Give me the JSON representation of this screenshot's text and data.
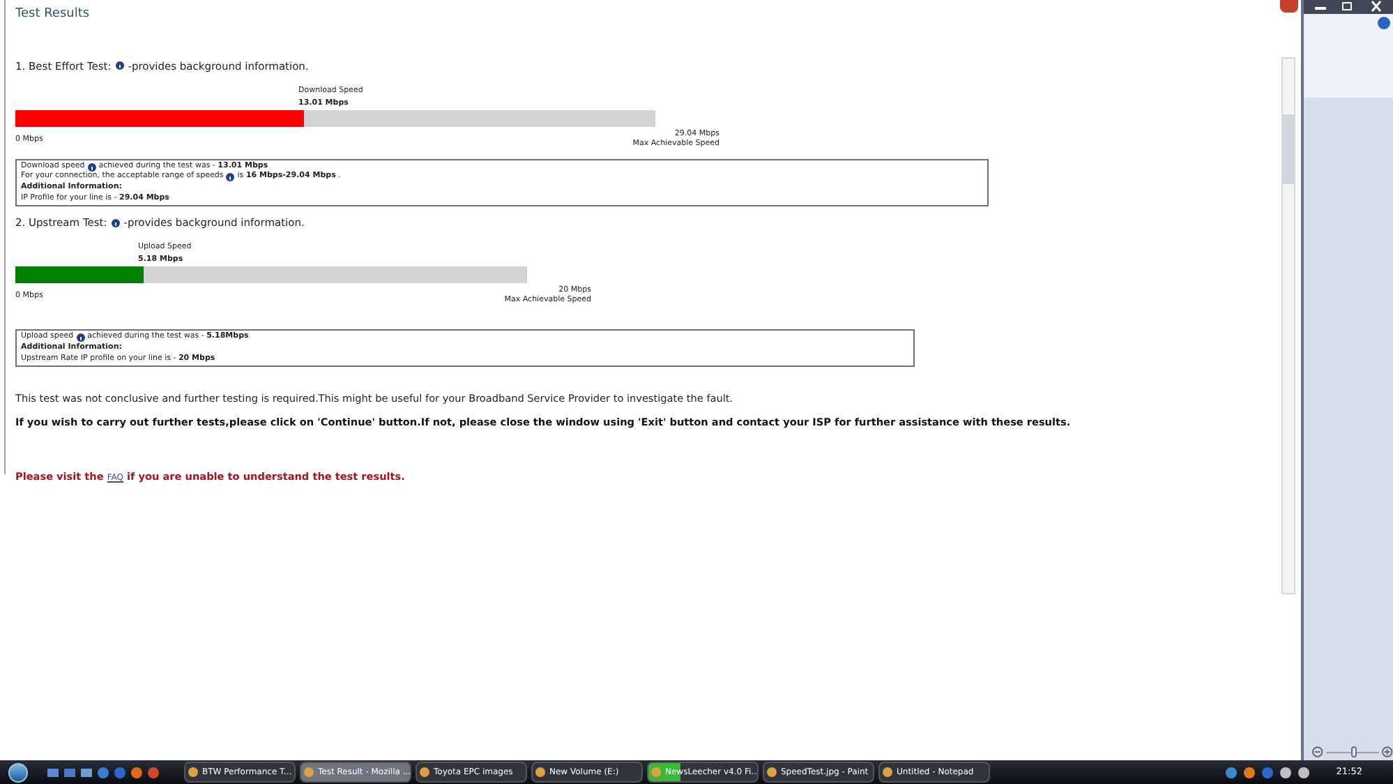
{
  "page": {
    "title": "Test Results",
    "tests": [
      {
        "name": "1. Best Effort Test:",
        "hint": "-provides background information.",
        "speed_label": "Download Speed",
        "speed": "13.01 Mbps",
        "level": 0.45,
        "color": "#ff0000",
        "min": "0 Mbps",
        "max": "29.04 Mbps",
        "max_caption": "Max Achievable Speed",
        "details": [
          {
            "kind": "text",
            "segments": [
              "Download speed",
              "achieved during the test was - **13.01 Mbps**"
            ]
          },
          {
            "kind": "text",
            "segments": [
              "For your connection, the acceptable range of speeds",
              "is **16 Mbps-29.04 Mbps** ."
            ]
          },
          {
            "kind": "label",
            "segments": [
              "Additional Information:"
            ]
          },
          {
            "kind": "text",
            "segments": [
              "IP Profile for your line is - **29.04 Mbps**"
            ]
          }
        ]
      },
      {
        "name": "2. Upstream Test:",
        "hint": "-provides background information.",
        "speed_label": "Upload Speed",
        "speed": "5.18 Mbps",
        "level": 0.25,
        "color": "#008000",
        "min": "0 Mbps",
        "max": "20 Mbps",
        "max_caption": "Max Achievable Speed",
        "details": [
          {
            "kind": "text",
            "segments": [
              "Upload speed",
              " achieved during the test was - **5.18Mbps**"
            ]
          },
          {
            "kind": "label",
            "segments": [
              "Additional Information:"
            ]
          },
          {
            "kind": "text",
            "segments": [
              "Upstream Rate IP profile on your line is - **20 Mbps**"
            ]
          }
        ]
      }
    ],
    "conclusion": "This test was not conclusive and further testing is required.This might be useful for your Broadband Service Provider to investigate the fault.",
    "instruction": "If you wish to carry out further tests,please click on 'Continue' button.If not, please close the window using 'Exit' button and contact your ISP for further assistance with these results.",
    "faq": {
      "before": "Please visit the",
      "link": "FAQ",
      "after": "if you are unable to understand the test results."
    }
  },
  "side_window": {
    "zoom_slider": {
      "level": 0.5
    }
  },
  "taskbar": {
    "tasks": [
      {
        "label": "BTW Performance T...",
        "selected": false
      },
      {
        "label": "Test Result - Mozilla ...",
        "selected": true
      },
      {
        "label": "Toyota EPC images",
        "selected": false
      },
      {
        "label": "New Volume (E:)",
        "selected": false
      },
      {
        "label": "NewsLeecher v4.0 Fi...",
        "selected": false,
        "level": 0.3
      },
      {
        "label": "SpeedTest.jpg - Paint",
        "selected": false
      },
      {
        "label": "Untitled - Notepad",
        "selected": false
      }
    ],
    "clock": "21:52"
  }
}
